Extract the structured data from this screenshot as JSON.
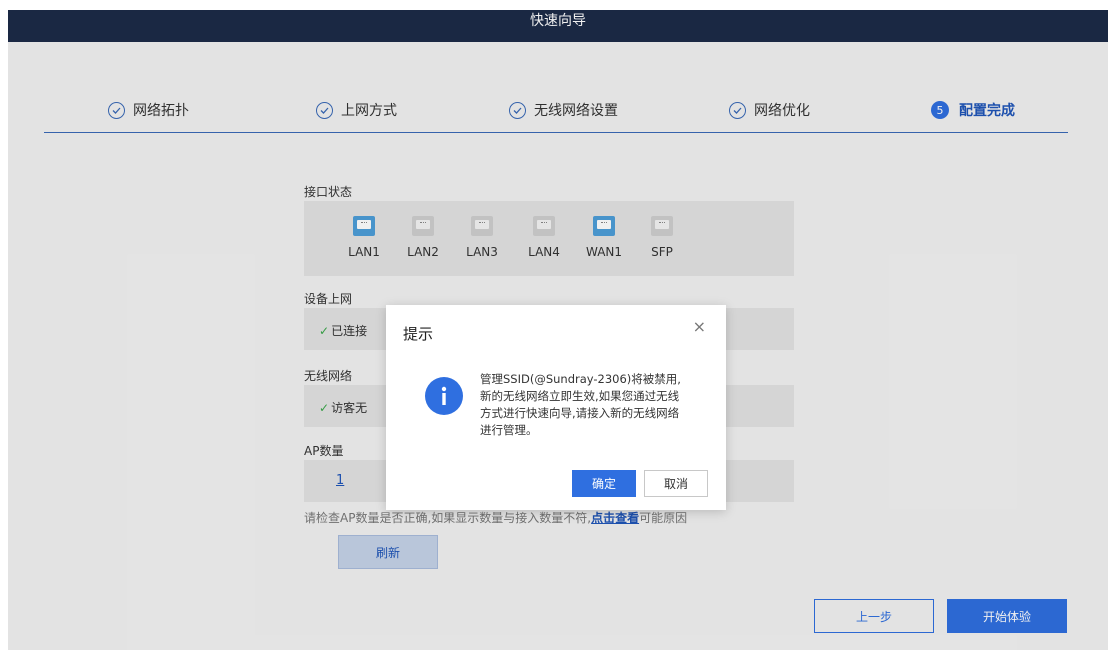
{
  "header": {
    "title": "快速向导"
  },
  "steps": [
    {
      "label": "网络拓扑",
      "state": "done"
    },
    {
      "label": "上网方式",
      "state": "done"
    },
    {
      "label": "无线网络设置",
      "state": "done"
    },
    {
      "label": "网络优化",
      "state": "done"
    },
    {
      "label": "配置完成",
      "number": "5",
      "state": "active"
    }
  ],
  "interface_status": {
    "label": "接口状态",
    "ports": [
      {
        "name": "LAN1",
        "active": true
      },
      {
        "name": "LAN2",
        "active": false
      },
      {
        "name": "LAN3",
        "active": false
      },
      {
        "name": "LAN4",
        "active": false
      },
      {
        "name": "WAN1",
        "active": true
      },
      {
        "name": "SFP",
        "active": false
      }
    ]
  },
  "device_online": {
    "label": "设备上网",
    "status": "已连接"
  },
  "wireless": {
    "label": "无线网络",
    "status": "访客无"
  },
  "ap_count": {
    "label": "AP数量",
    "value": "1"
  },
  "note": {
    "text": "请检查AP数量是否正确,如果显示数量与接入数量不符,",
    "link": "点击查看",
    "suffix": "可能原因"
  },
  "buttons": {
    "refresh": "刷新",
    "prev": "上一步",
    "start": "开始体验"
  },
  "dialog": {
    "title": "提示",
    "close": "×",
    "icon": "i",
    "message": "管理SSID(@Sundray-2306)将被禁用,新的无线网络立即生效,如果您通过无线方式进行快速向导,请接入新的无线网络进行管理。",
    "ok": "确定",
    "cancel": "取消"
  },
  "colors": {
    "header_bg": "#1c2b48",
    "accent": "#2f6fe0",
    "port_on": "#4d9ed8",
    "success": "#3aa64a"
  }
}
